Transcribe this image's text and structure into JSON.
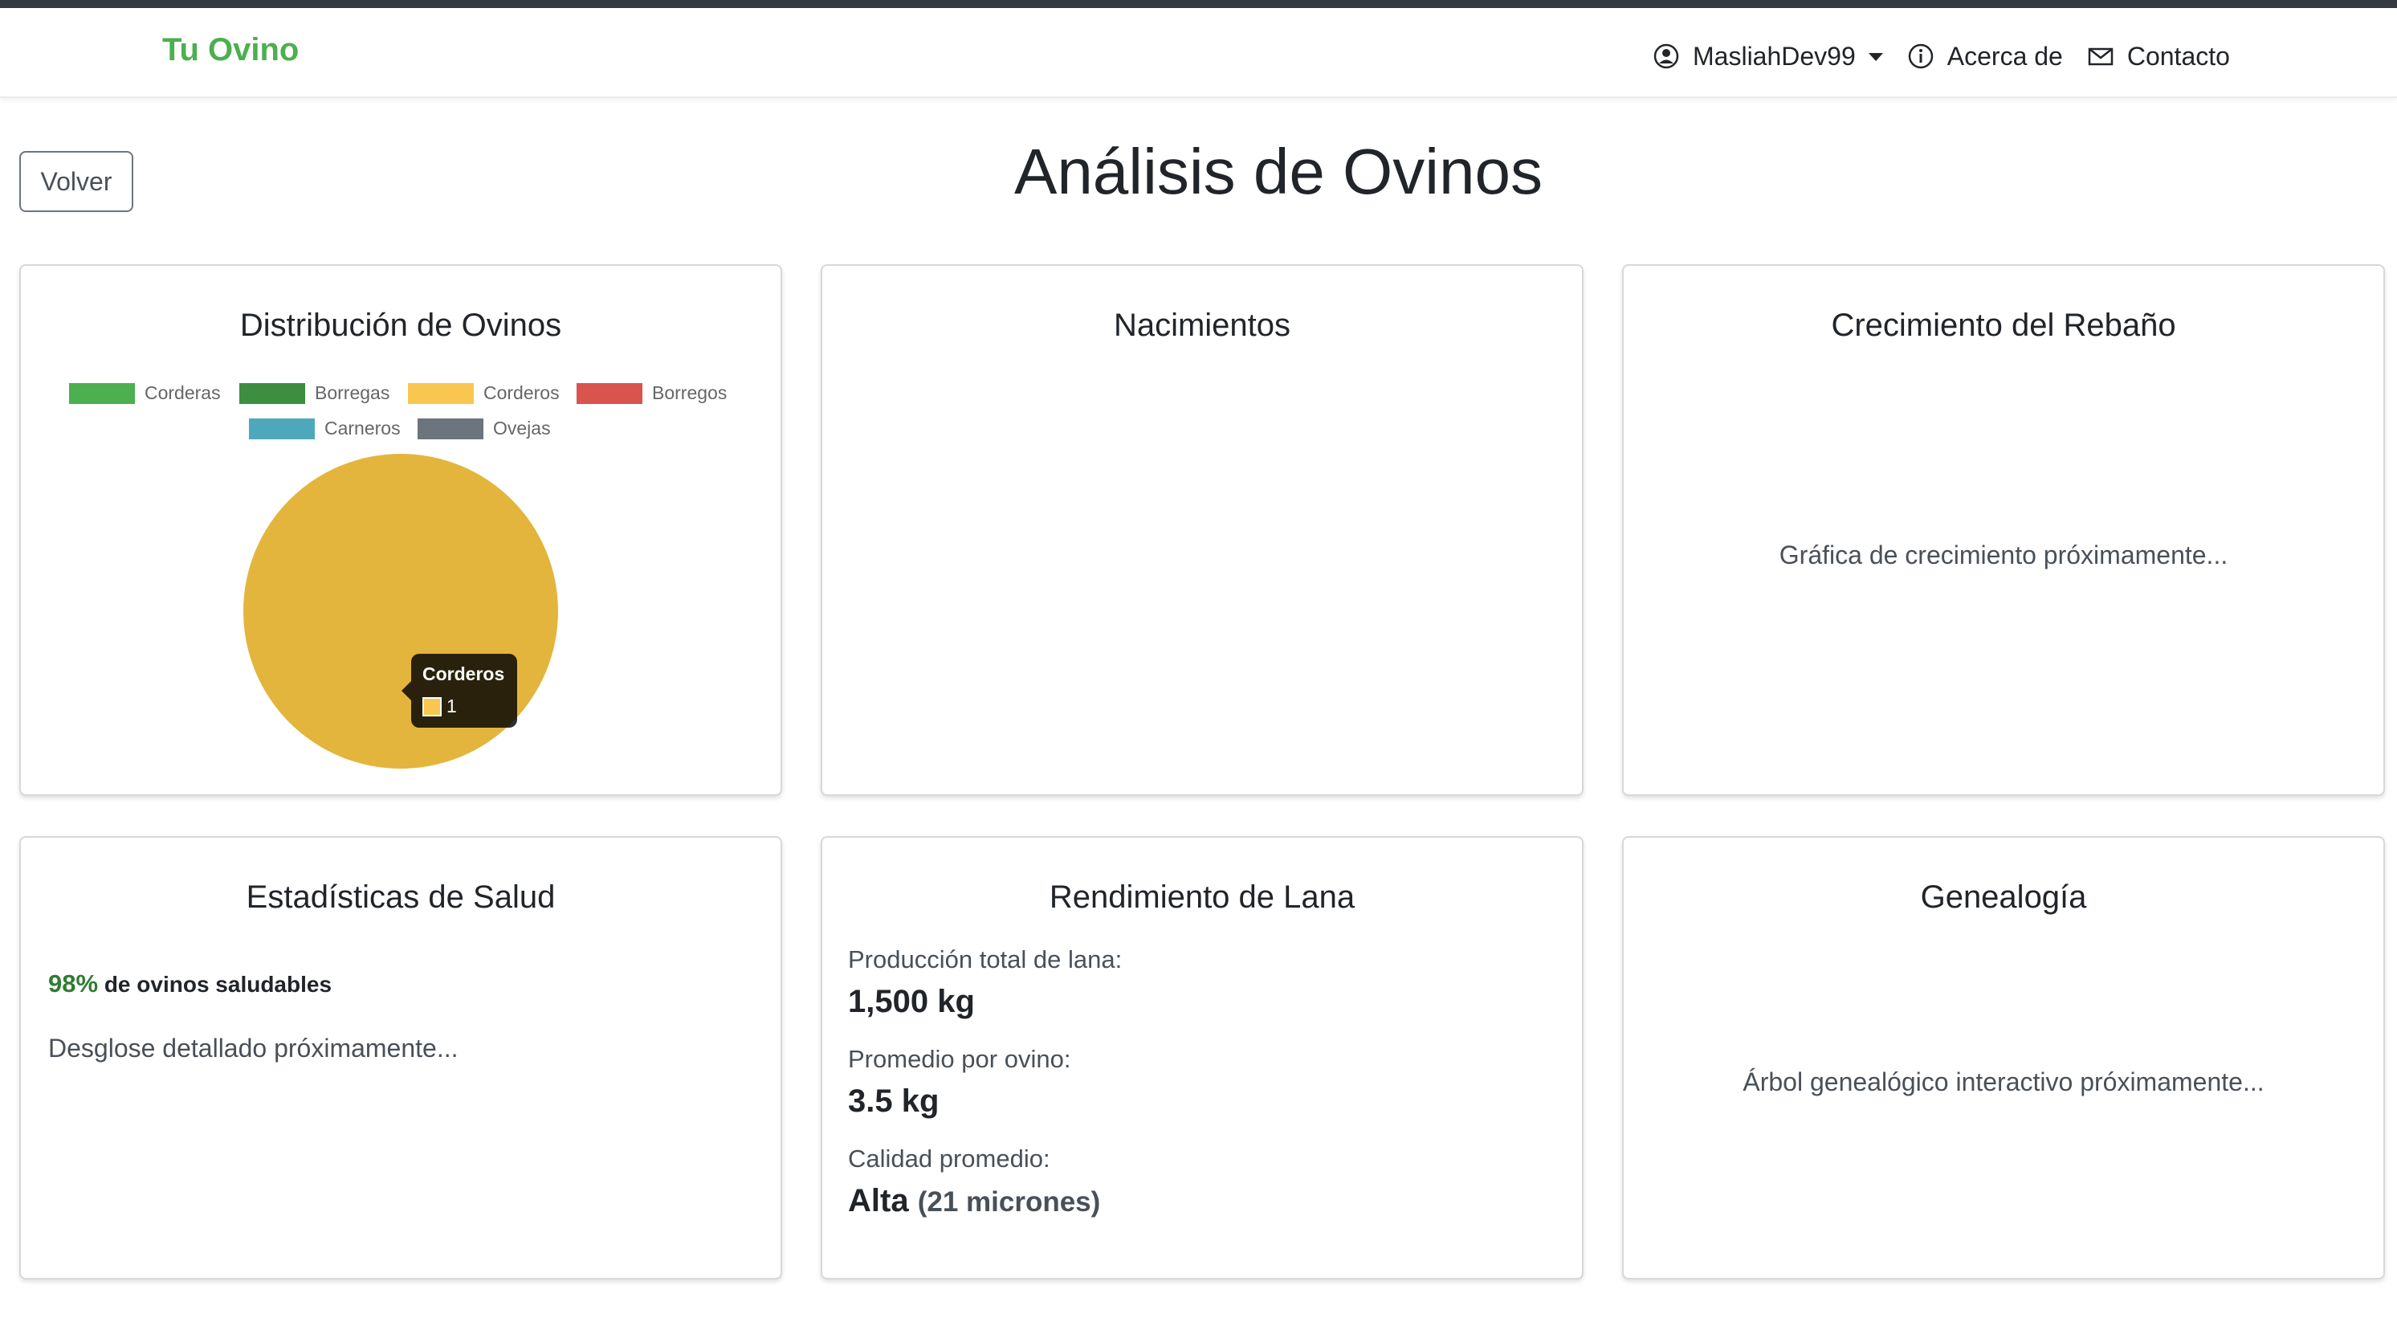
{
  "navbar": {
    "brand": "Tu Ovino",
    "user": "MasliahDev99",
    "about": "Acerca de",
    "contact": "Contacto"
  },
  "page": {
    "back_label": "Volver",
    "title": "Análisis de Ovinos"
  },
  "cards": {
    "distribution": {
      "title": "Distribución de Ovinos"
    },
    "births": {
      "title": "Nacimientos"
    },
    "growth": {
      "title": "Crecimiento del Rebaño",
      "placeholder": "Gráfica de crecimiento próximamente..."
    },
    "health": {
      "title": "Estadísticas de Salud",
      "percent": "98%",
      "percent_label": "de ovinos saludables",
      "details": "Desglose detallado próximamente..."
    },
    "wool": {
      "title": "Rendimiento de Lana",
      "total_label": "Producción total de lana:",
      "total_value": "1,500 kg",
      "avg_label": "Promedio por ovino:",
      "avg_value": "3.5 kg",
      "quality_label": "Calidad promedio:",
      "quality_value": "Alta",
      "quality_extra": "(21 micrones)"
    },
    "genealogy": {
      "title": "Genealogía",
      "placeholder": "Árbol genealógico interactivo próximamente..."
    }
  },
  "chart_data": {
    "type": "pie",
    "categories": [
      "Corderas",
      "Borregas",
      "Corderos",
      "Borregos",
      "Carneros",
      "Ovejas"
    ],
    "values": [
      0,
      0,
      1,
      0,
      0,
      0
    ],
    "colors": [
      "#4caf50",
      "#3e8e41",
      "#f9c74f",
      "#d9534f",
      "#4ea8bb",
      "#6c757d"
    ],
    "slice_color": "#e3b53c",
    "legend_position": "top",
    "tooltip": {
      "label": "Corderos",
      "value": "1"
    }
  }
}
